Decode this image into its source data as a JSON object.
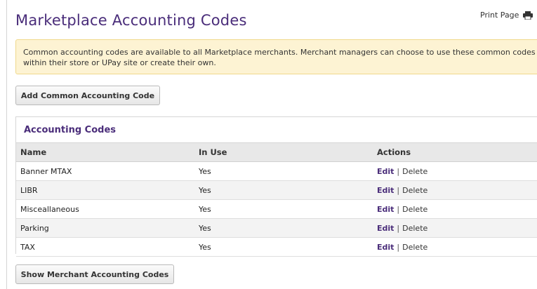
{
  "page": {
    "title": "Marketplace Accounting Codes",
    "print_label": "Print Page"
  },
  "notice": {
    "text": "Common accounting codes are available to all Marketplace merchants. Merchant managers can choose to use these common codes within their store or UPay site or create their own."
  },
  "buttons": {
    "add_common": "Add Common Accounting Code",
    "show_merchant": "Show Merchant Accounting Codes"
  },
  "panel": {
    "title": "Accounting Codes",
    "columns": [
      "Name",
      "In Use",
      "Actions"
    ],
    "rows": [
      {
        "name": "Banner MTAX",
        "in_use": "Yes",
        "edit": "Edit",
        "sep": "|",
        "delete": "Delete"
      },
      {
        "name": "LIBR",
        "in_use": "Yes",
        "edit": "Edit",
        "sep": "|",
        "delete": "Delete"
      },
      {
        "name": "Misceallaneous",
        "in_use": "Yes",
        "edit": "Edit",
        "sep": "|",
        "delete": "Delete"
      },
      {
        "name": "Parking",
        "in_use": "Yes",
        "edit": "Edit",
        "sep": "|",
        "delete": "Delete"
      },
      {
        "name": "TAX",
        "in_use": "Yes",
        "edit": "Edit",
        "sep": "|",
        "delete": "Delete"
      }
    ]
  },
  "icons": {
    "print": "printer-icon"
  },
  "colors": {
    "title": "#4a2d7a",
    "notice_bg": "#fdf3d3",
    "notice_border": "#f0d98c"
  }
}
